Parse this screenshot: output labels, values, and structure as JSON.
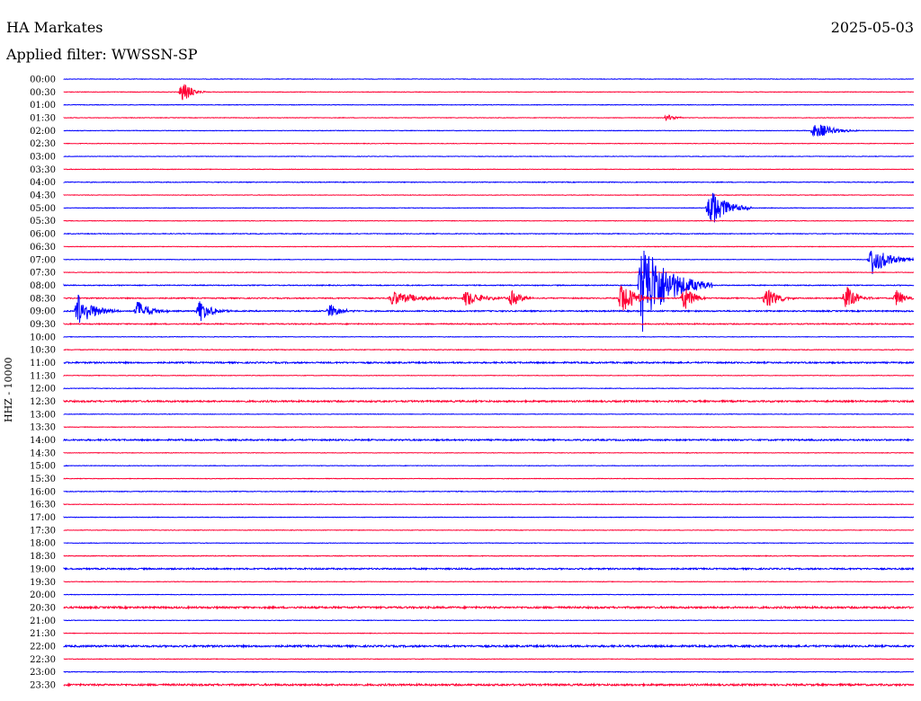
{
  "header": {
    "station": "HA Markates",
    "date": "2025-05-03",
    "filter_label": "Applied filter: WWSSN-SP"
  },
  "colors": {
    "even_trace": "#0000ff",
    "odd_trace": "#ff0033",
    "text": "#000000"
  },
  "chart_data": {
    "type": "line",
    "title": "",
    "ylabel": "HHZ - 10000",
    "xlabel": "",
    "time_labels": [
      "00:00",
      "00:30",
      "01:00",
      "01:30",
      "02:00",
      "02:30",
      "03:00",
      "03:30",
      "04:00",
      "04:30",
      "05:00",
      "05:30",
      "06:00",
      "06:30",
      "07:00",
      "07:30",
      "08:00",
      "08:30",
      "09:00",
      "09:30",
      "10:00",
      "10:30",
      "11:00",
      "11:30",
      "12:00",
      "12:30",
      "13:00",
      "13:30",
      "14:00",
      "14:30",
      "15:00",
      "15:30",
      "16:00",
      "16:30",
      "17:00",
      "17:30",
      "18:00",
      "18:30",
      "19:00",
      "19:30",
      "20:00",
      "20:30",
      "21:00",
      "21:30",
      "22:00",
      "22:30",
      "23:00",
      "23:30"
    ],
    "row_minutes": 30,
    "noise_levels": [
      0.3,
      0.3,
      0.3,
      0.3,
      0.3,
      0.3,
      0.3,
      0.3,
      0.4,
      0.3,
      0.3,
      0.3,
      0.4,
      0.3,
      0.3,
      0.3,
      0.5,
      0.6,
      0.7,
      0.6,
      0.3,
      0.4,
      0.8,
      0.3,
      0.3,
      0.9,
      0.3,
      0.3,
      0.8,
      0.3,
      0.3,
      0.3,
      0.4,
      0.3,
      0.3,
      0.3,
      0.3,
      0.4,
      0.8,
      0.3,
      0.3,
      1.0,
      0.3,
      0.3,
      1.0,
      0.3,
      0.4,
      1.0
    ],
    "events": [
      {
        "row": 1,
        "minute": 4.2,
        "amplitude": 14,
        "duration_min": 0.8
      },
      {
        "row": 3,
        "minute": 21.3,
        "amplitude": 4,
        "duration_min": 0.8
      },
      {
        "row": 4,
        "minute": 26.5,
        "amplitude": 10,
        "duration_min": 1.6
      },
      {
        "row": 10,
        "minute": 22.8,
        "amplitude": 24,
        "duration_min": 1.5
      },
      {
        "row": 14,
        "minute": 28.5,
        "amplitude": 18,
        "duration_min": 1.6
      },
      {
        "row": 16,
        "minute": 20.4,
        "amplitude": 55,
        "duration_min": 2.5
      },
      {
        "row": 17,
        "minute": 11.6,
        "amplitude": 9,
        "duration_min": 2.2
      },
      {
        "row": 17,
        "minute": 14.2,
        "amplitude": 10,
        "duration_min": 1.5
      },
      {
        "row": 17,
        "minute": 15.8,
        "amplitude": 9,
        "duration_min": 1.0
      },
      {
        "row": 17,
        "minute": 19.7,
        "amplitude": 20,
        "duration_min": 1.2
      },
      {
        "row": 17,
        "minute": 21.9,
        "amplitude": 15,
        "duration_min": 0.9
      },
      {
        "row": 17,
        "minute": 24.8,
        "amplitude": 14,
        "duration_min": 1.0
      },
      {
        "row": 17,
        "minute": 27.6,
        "amplitude": 15,
        "duration_min": 1.0
      },
      {
        "row": 17,
        "minute": 29.4,
        "amplitude": 10,
        "duration_min": 0.8
      },
      {
        "row": 18,
        "minute": 0.5,
        "amplitude": 20,
        "duration_min": 1.5
      },
      {
        "row": 18,
        "minute": 2.6,
        "amplitude": 12,
        "duration_min": 1.2
      },
      {
        "row": 18,
        "minute": 4.8,
        "amplitude": 12,
        "duration_min": 1.2
      },
      {
        "row": 18,
        "minute": 9.4,
        "amplitude": 8,
        "duration_min": 1.0
      }
    ]
  }
}
